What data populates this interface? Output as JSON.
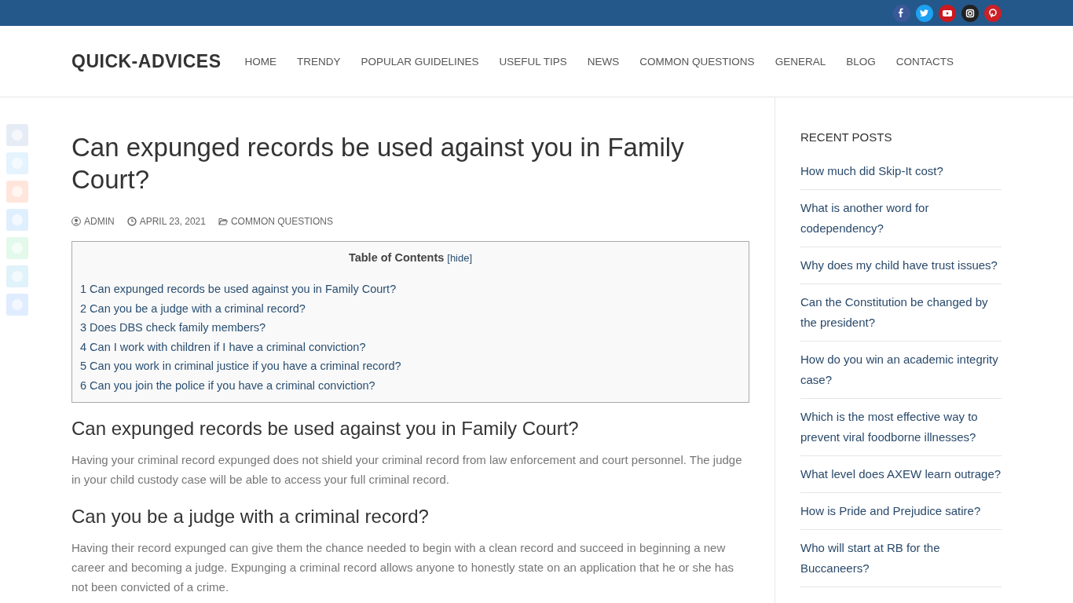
{
  "site": {
    "logo": "QUICK-ADVICES"
  },
  "nav": [
    "HOME",
    "TRENDY",
    "POPULAR GUIDELINES",
    "USEFUL TIPS",
    "NEWS",
    "COMMON QUESTIONS",
    "GENERAL",
    "BLOG",
    "CONTACTS"
  ],
  "article": {
    "title": "Can expunged records be used against you in Family Court?",
    "meta": {
      "author": "ADMIN",
      "date": "APRIL 23, 2021",
      "category": "COMMON QUESTIONS"
    },
    "toc": {
      "title": "Table of Contents",
      "toggle": "[hide]",
      "items": [
        "1 Can expunged records be used against you in Family Court?",
        "2 Can you be a judge with a criminal record?",
        "3 Does DBS check family members?",
        "4 Can I work with children if I have a criminal conviction?",
        "5 Can you work in criminal justice if you have a criminal record?",
        "6 Can you join the police if you have a criminal conviction?"
      ]
    },
    "sections": [
      {
        "heading": "Can expunged records be used against you in Family Court?",
        "paragraph": "Having your criminal record expunged does not shield your criminal record from law enforcement and court personnel. The judge in your child custody case will be able to access your full criminal record."
      },
      {
        "heading": "Can you be a judge with a criminal record?",
        "paragraph": "Having their record expunged can give them the chance needed to begin with a clean record and succeed in beginning a new career and becoming a judge. Expunging a criminal record allows anyone to honestly state on an application that he or she has not been convicted of a crime."
      }
    ]
  },
  "sidebar": {
    "title": "RECENT POSTS",
    "posts": [
      "How much did Skip-It cost?",
      "What is another word for codependency?",
      "Why does my child have trust issues?",
      "Can the Constitution be changed by the president?",
      "How do you win an academic integrity case?",
      "Which is the most effective way to prevent viral foodborne illnesses?",
      "What level does AXEW learn outrage?",
      "How is Pride and Prejudice satire?",
      "Who will start at RB for the Buccaneers?"
    ]
  }
}
